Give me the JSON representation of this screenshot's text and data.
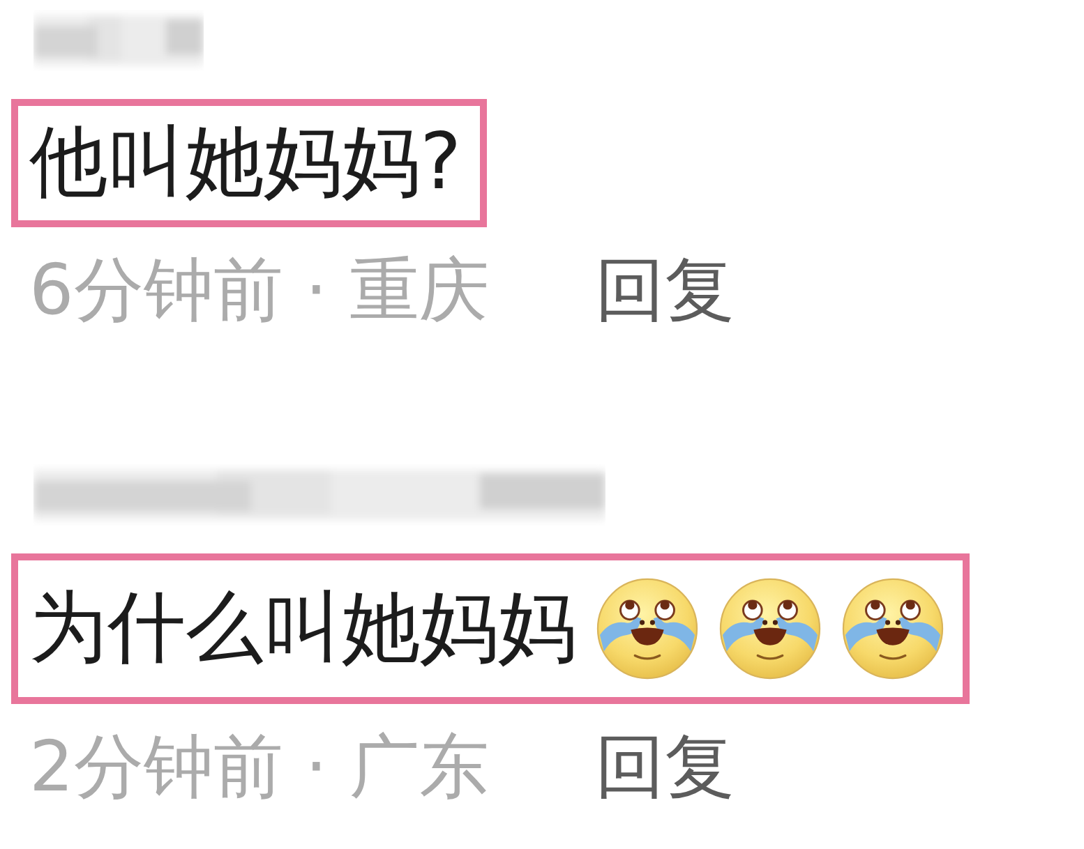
{
  "comments": [
    {
      "author_blurred": true,
      "text": "他叫她妈妈?",
      "time_location": "6分钟前 · 重庆",
      "reply_label": "回复"
    },
    {
      "author_blurred": true,
      "text": "为什么叫她妈妈",
      "emojis": [
        {
          "kind": "teary-laugh"
        },
        {
          "kind": "teary-laugh"
        },
        {
          "kind": "teary-laugh"
        }
      ],
      "time_location": "2分钟前 · 广东",
      "reply_label": "回复"
    }
  ]
}
